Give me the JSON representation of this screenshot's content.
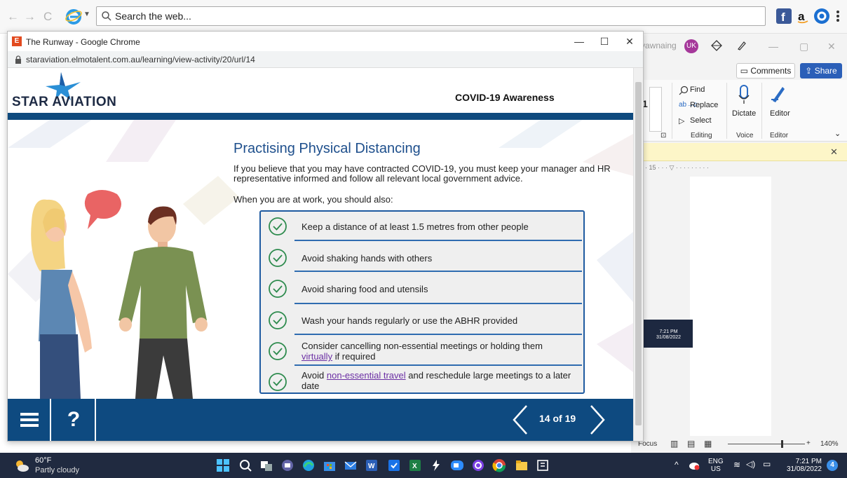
{
  "bg_browser": {
    "search_placeholder": "Search the web...",
    "nav_back": "←",
    "nav_forward": "→",
    "nav_refresh": "C"
  },
  "word": {
    "account_name": "yawnaing",
    "avatar_initials": "UK",
    "comments_label": "Comments",
    "share_label": "Share",
    "find_label": "Find",
    "replace_label": "Replace",
    "select_label": "Select",
    "dictate_label": "Dictate",
    "editor_label": "Editor",
    "group_editing": "Editing",
    "group_voice": "Voice",
    "group_editor": "Editor",
    "font_size_fragment": "1",
    "focus_label": "Focus",
    "zoom_level": "140%",
    "mini_time": "7:21 PM",
    "mini_date": "31/08/2022"
  },
  "popup": {
    "title": "The Runway - Google Chrome",
    "favicon_letter": "E",
    "url": "staraviation.elmotalent.com.au/learning/view-activity/20/url/14"
  },
  "course": {
    "logo_text": "STAR AVIATION",
    "module_title": "COVID-19 Awareness",
    "section_title": "Practising Physical Distancing",
    "intro": "If you believe that you may have contracted COVID-19, you must keep your manager and HR representative informed and follow all relevant local government advice.",
    "lead_in": "When you are at work, you should also:",
    "items": [
      {
        "text": "Keep a distance of at least 1.5 metres from other people"
      },
      {
        "text": "Avoid shaking hands with others"
      },
      {
        "text": "Avoid sharing food and utensils"
      },
      {
        "text": "Wash your hands regularly or use the ABHR provided"
      },
      {
        "pre": "Consider cancelling non-essential meetings or holding them ",
        "link": "virtually",
        "post": " if required"
      },
      {
        "pre": "Avoid ",
        "link": "non-essential travel",
        "post": " and reschedule large meetings to a later date"
      }
    ],
    "page_indicator": "14 of 19",
    "help_label": "?"
  },
  "taskbar": {
    "weather_temp": "60°F",
    "weather_desc": "Partly cloudy",
    "language": "ENG",
    "region": "US",
    "time": "7:21 PM",
    "date": "31/08/2022",
    "notification_count": "4"
  },
  "colors": {
    "brand_navy": "#0e4a80",
    "heading_blue": "#1e4f8c",
    "link_purple": "#6b2fa4",
    "check_green": "#2e8b4e"
  }
}
